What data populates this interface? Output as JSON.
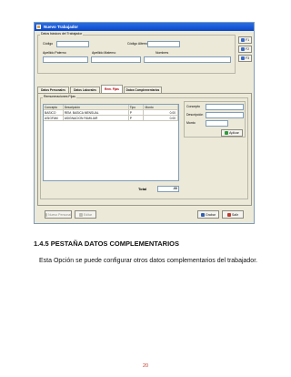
{
  "window": {
    "title": "Nuevo Trabajador",
    "group_basic": "Datos básicos del Trabajador",
    "codigo_label": "Código",
    "codigo_alterno_label": "Código Alterno",
    "apellido_paterno_label": "Apellido Paterno",
    "apellido_materno_label": "Apellido Materno",
    "nombres_label": "Nombres",
    "side_btn_1": "F1",
    "side_btn_2": "F2",
    "side_btn_3": "F3",
    "tabs": [
      {
        "label": "Datos Personales"
      },
      {
        "label": "Datos Laborales"
      },
      {
        "label": "Rem. Fijas"
      },
      {
        "label": "Datos Complementarios"
      }
    ],
    "group_rem": "Remuneraciones Fijas",
    "grid": {
      "headers": [
        "Concepto",
        "Descripción",
        "Tipo",
        "Monto"
      ],
      "rows": [
        [
          "BASICO",
          "REM. BASICA MENSUAL",
          "P",
          "0.00"
        ],
        [
          "ASIGFAM",
          "ASIGNACION FAMILIAR",
          "P",
          "0.00"
        ]
      ]
    },
    "concepto_label": "Concepto",
    "descripcion_label": "Descripción",
    "monto_label": "Monto",
    "aplicar_label": "Aplicar",
    "total_label": "Total",
    "total_value": ".00",
    "btn_nuevo": "Nuevo Personal",
    "btn_editar": "Editar",
    "btn_grabar": "Grabar",
    "btn_salir": "Salir"
  },
  "doc": {
    "heading": "1.4.5   PESTAÑA DATOS COMPLEMENTARIOS",
    "paragraph": "Esta Opción se puede configurar otros datos complementarios del trabajador.",
    "page_number": "20"
  }
}
